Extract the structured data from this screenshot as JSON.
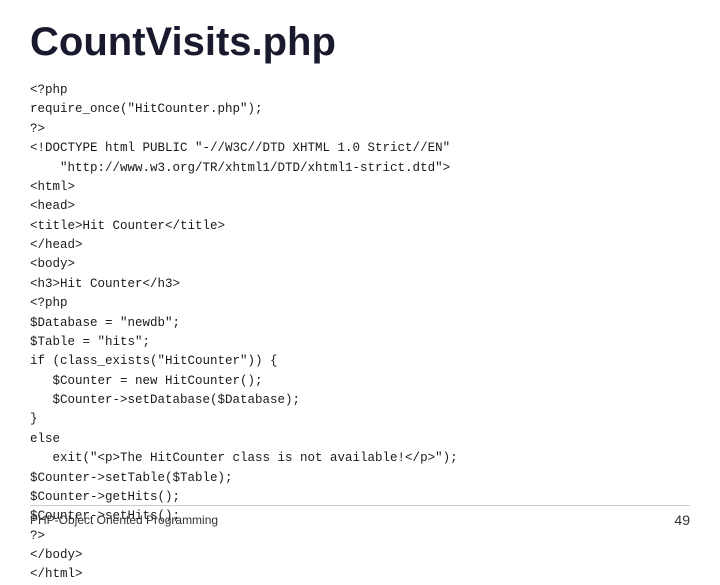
{
  "slide": {
    "title": "CountVisits.php",
    "footer_left": "PHP-Object Oriented Programming",
    "footer_right": "49",
    "code_lines": [
      "<?php",
      "require_once(\"HitCounter.php\");",
      "?>",
      "<!DOCTYPE html PUBLIC \"-//W3C//DTD XHTML 1.0 Strict//EN\"",
      "    \"http://www.w3.org/TR/xhtml1/DTD/xhtml1-strict.dtd\">",
      "<html>",
      "<head>",
      "<title>Hit Counter</title>",
      "</head>",
      "<body>",
      "<h3>Hit Counter</h3>",
      "<?php",
      "$Database = \"newdb\";",
      "$Table = \"hits\";",
      "if (class_exists(\"HitCounter\")) {",
      "   $Counter = new HitCounter();",
      "   $Counter->setDatabase($Database);",
      "}",
      "else",
      "   exit(\"<p>The HitCounter class is not available!</p>\");",
      "$Counter->setTable($Table);",
      "$Counter->getHits();",
      "$Counter->setHits();",
      "?>",
      "</body>",
      "</html>"
    ]
  }
}
